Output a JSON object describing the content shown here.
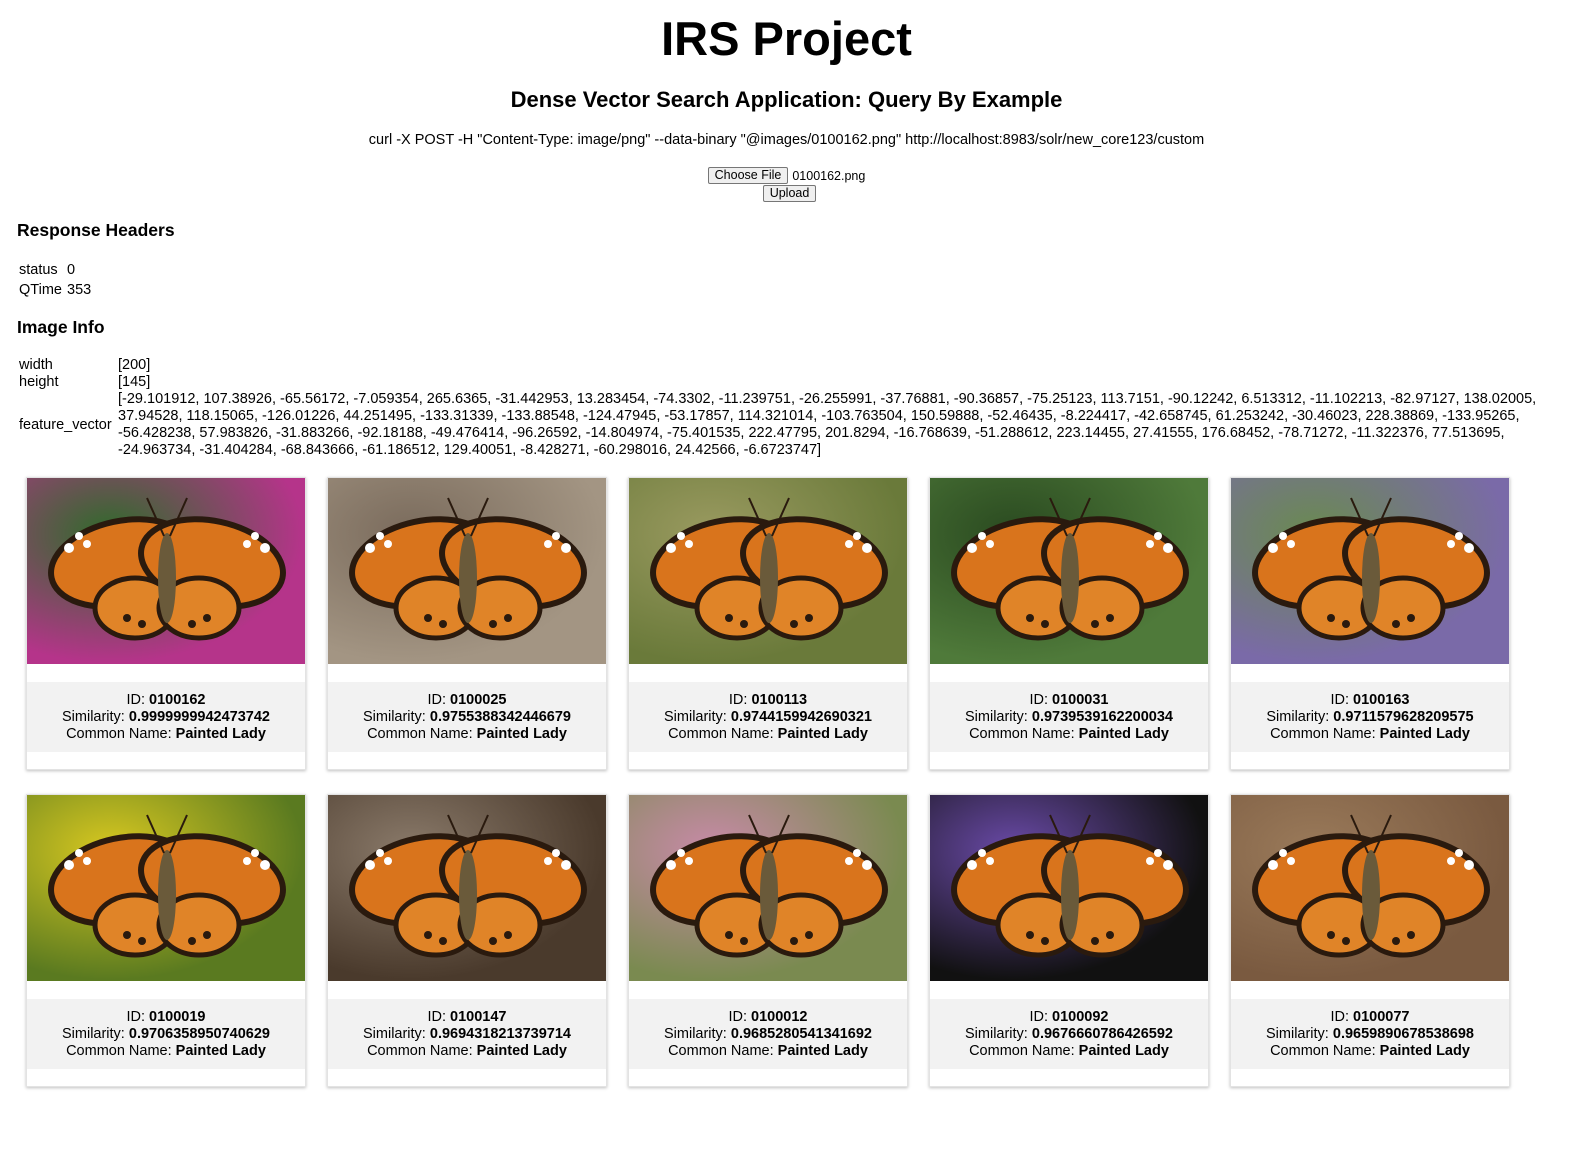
{
  "title": "IRS Project",
  "subtitle": "Dense Vector Search Application: Query By Example",
  "curl_command": "curl -X POST -H \"Content-Type: image/png\" --data-binary \"@images/0100162.png\" http://localhost:8983/solr/new_core123/custom",
  "upload": {
    "choose_file_label": "Choose File",
    "file_name": "0100162.png",
    "upload_label": "Upload"
  },
  "response_headers": {
    "heading": "Response Headers",
    "status_key": "status",
    "status_value": "0",
    "qtime_key": "QTime",
    "qtime_value": "353"
  },
  "image_info": {
    "heading": "Image Info",
    "width_key": "width",
    "width_value": "[200]",
    "height_key": "height",
    "height_value": "[145]",
    "feature_vector_key": "feature_vector",
    "feature_vector_value": "[-29.101912, 107.38926, -65.56172, -7.059354, 265.6365, -31.442953, 13.283454, -74.3302, -11.239751, -26.255991, -37.76881, -90.36857, -75.25123, 113.7151, -90.12242, 6.513312, -11.102213, -82.97127, 138.02005, 37.94528, 118.15065, -126.01226, 44.251495, -133.31339, -133.88548, -124.47945, -53.17857, 114.321014, -103.763504, 150.59888, -52.46435, -8.224417, -42.658745, 61.253242, -30.46023, 228.38869, -133.95265, -56.428238, 57.983826, -31.883266, -92.18188, -49.476414, -96.26592, -14.804974, -75.401535, 222.47795, 201.8294, -16.768639, -51.288612, 223.14455, 27.41555, 176.68452, -78.71272, -11.322376, 77.513695, -24.963734, -31.404284, -68.843666, -61.186512, 129.40051, -8.428271, -60.298016, 24.42566, -6.6723747]"
  },
  "labels": {
    "id": "ID: ",
    "similarity": "Similarity: ",
    "common_name": "Common Name: "
  },
  "results": [
    {
      "id": "0100162",
      "similarity": "0.9999999942473742",
      "common_name": "Painted Lady",
      "bg": "#b5348a",
      "bg2": "#2f6b2a"
    },
    {
      "id": "0100025",
      "similarity": "0.9755388342446679",
      "common_name": "Painted Lady",
      "bg": "#a39583",
      "bg2": "#7a6b5c"
    },
    {
      "id": "0100113",
      "similarity": "0.9744159942690321",
      "common_name": "Painted Lady",
      "bg": "#6a7a3a",
      "bg2": "#9a9a60"
    },
    {
      "id": "0100031",
      "similarity": "0.9739539162200034",
      "common_name": "Painted Lady",
      "bg": "#4f7a3a",
      "bg2": "#2a4a20"
    },
    {
      "id": "0100163",
      "similarity": "0.9711579628209575",
      "common_name": "Painted Lady",
      "bg": "#7a6aa8",
      "bg2": "#6a8a50"
    },
    {
      "id": "0100019",
      "similarity": "0.9706358950740629",
      "common_name": "Painted Lady",
      "bg": "#5a7a20",
      "bg2": "#d8c820"
    },
    {
      "id": "0100147",
      "similarity": "0.9694318213739714",
      "common_name": "Painted Lady",
      "bg": "#4a3a2c",
      "bg2": "#8a7a6a"
    },
    {
      "id": "0100012",
      "similarity": "0.9685280541341692",
      "common_name": "Painted Lady",
      "bg": "#7a8a50",
      "bg2": "#c88aa8"
    },
    {
      "id": "0100092",
      "similarity": "0.9676660786426592",
      "common_name": "Painted Lady",
      "bg": "#111111",
      "bg2": "#6a4aa8"
    },
    {
      "id": "0100077",
      "similarity": "0.9659890678538698",
      "common_name": "Painted Lady",
      "bg": "#7a5a40",
      "bg2": "#9a7a5a"
    }
  ]
}
